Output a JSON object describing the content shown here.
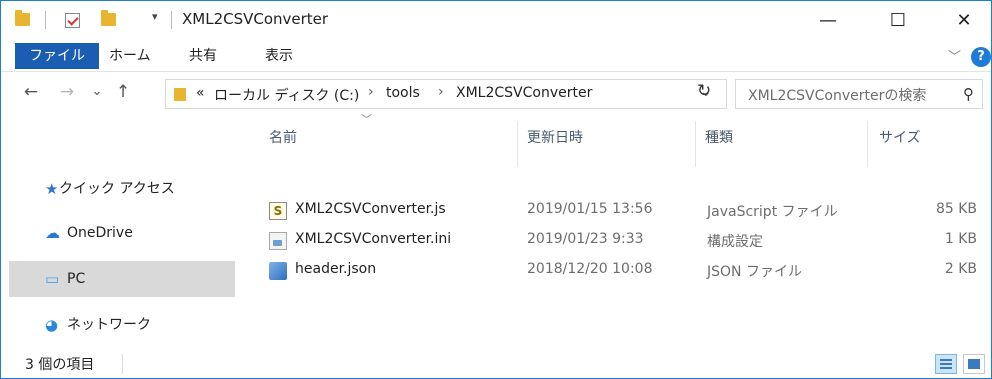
{
  "window": {
    "title": "XML2CSVConverter",
    "qat_dropdown": "▾",
    "minimize": "—",
    "maximize": "☐",
    "close": "✕"
  },
  "ribbon": {
    "tabs": [
      "ファイル",
      "ホーム",
      "共有",
      "表示"
    ],
    "expand": "﹀",
    "help": "?"
  },
  "nav": {
    "back": "←",
    "forward": "→",
    "recent": "⌄",
    "up": "↑",
    "overflow": "«",
    "breadcrumb": [
      "ローカル ディスク (C:)",
      "tools",
      "XML2CSVConverter"
    ],
    "crumb_sep": "›",
    "address_dropdown": "⌄",
    "refresh": "↻",
    "search_placeholder": "XML2CSVConverterの検索",
    "search_icon": "⚲"
  },
  "sidebar": {
    "items": [
      {
        "label": "クイック アクセス",
        "icon": "★"
      },
      {
        "label": "OneDrive",
        "icon": "☁"
      },
      {
        "label": "PC",
        "icon": "▭"
      },
      {
        "label": "ネットワーク",
        "icon": "◕"
      }
    ]
  },
  "files": {
    "sort_indicator": "﹀",
    "columns": [
      "名前",
      "更新日時",
      "種類",
      "サイズ"
    ],
    "rows": [
      {
        "name": "XML2CSVConverter.js",
        "modified": "2019/01/15 13:56",
        "type": "JavaScript ファイル",
        "size": "85 KB",
        "icon": "S"
      },
      {
        "name": "XML2CSVConverter.ini",
        "modified": "2019/01/23 9:33",
        "type": "構成設定",
        "size": "1 KB",
        "icon": ""
      },
      {
        "name": "header.json",
        "modified": "2018/12/20 10:08",
        "type": "JSON ファイル",
        "size": "2 KB",
        "icon": ""
      }
    ]
  },
  "status": {
    "count": "3 個の項目"
  }
}
